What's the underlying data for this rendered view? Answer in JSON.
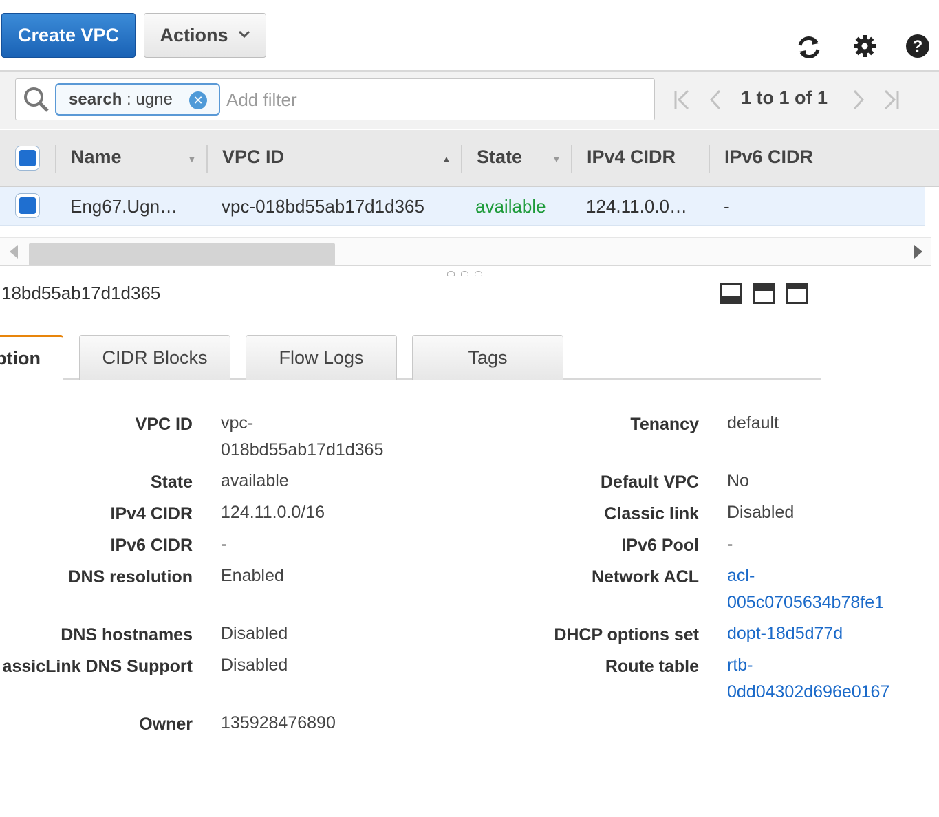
{
  "toolbar": {
    "create_label": "Create VPC",
    "actions_label": "Actions"
  },
  "filter": {
    "token_key": "search",
    "token_sep": " : ",
    "token_value": "ugne",
    "placeholder": "Add filter",
    "pagination": "1 to 1 of 1"
  },
  "table": {
    "columns": [
      "Name",
      "VPC ID",
      "State",
      "IPv4 CIDR",
      "IPv6 CIDR"
    ],
    "rows": [
      {
        "name": "Eng67.Ugn…",
        "vpc_id": "vpc-018bd55ab17d1d365",
        "state": "available",
        "ipv4": "124.11.0.0…",
        "ipv6": "-"
      }
    ]
  },
  "detail": {
    "title": "18bd55ab17d1d365",
    "tabs": [
      "ption",
      "CIDR Blocks",
      "Flow Logs",
      "Tags"
    ],
    "left": [
      {
        "label": "VPC ID",
        "value_1": "vpc-",
        "value_2": "018bd55ab17d1d365"
      },
      {
        "label": "State",
        "value": "available"
      },
      {
        "label": "IPv4 CIDR",
        "value": "124.11.0.0/16"
      },
      {
        "label": "IPv6 CIDR",
        "value": "-"
      },
      {
        "label": "DNS resolution",
        "value": "Enabled"
      },
      {
        "label": "DNS hostnames",
        "value": "Disabled"
      },
      {
        "label": "assicLink DNS Support",
        "value": "Disabled"
      },
      {
        "label": "Owner",
        "value": "135928476890"
      }
    ],
    "right": [
      {
        "label": "Tenancy",
        "value": "default"
      },
      {
        "label": "Default VPC",
        "value": "No"
      },
      {
        "label": "Classic link",
        "value": "Disabled"
      },
      {
        "label": "IPv6 Pool",
        "value": "-"
      },
      {
        "label": "Network ACL",
        "value_1": "acl-",
        "value_2": "005c0705634b78fe1"
      },
      {
        "label": "DHCP options set",
        "value": "dopt-18d5d77d"
      },
      {
        "label": "Route table",
        "value_1": "rtb-",
        "value_2": "0dd04302d696e0167"
      }
    ]
  },
  "colors": {
    "primary": "#1a62b5",
    "available": "#1e9b3a",
    "link": "#1b6ac9",
    "active_tab": "#e8850c"
  },
  "icons": [
    "refresh-icon",
    "gear-icon",
    "help-icon",
    "search-icon",
    "clear-icon",
    "chevron-down-icon",
    "first-page-icon",
    "prev-page-icon",
    "next-page-icon",
    "last-page-icon"
  ]
}
